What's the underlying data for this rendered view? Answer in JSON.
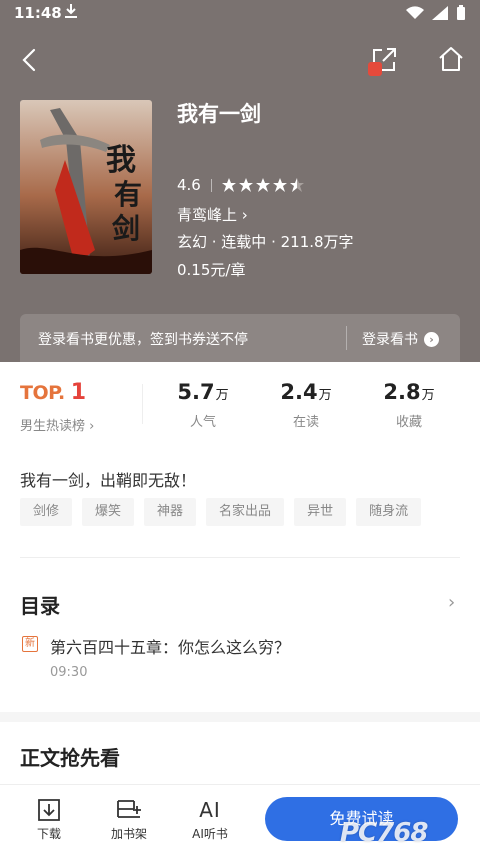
{
  "status_bar": {
    "time": "11:48"
  },
  "book": {
    "title": "我有一剑",
    "cover_title": "我有一剑",
    "rating": "4.6",
    "stars": 4.5,
    "author": "青鸾峰上",
    "meta": "玄幻 · 连载中 · 211.8万字",
    "price": "0.15元/章"
  },
  "promo": {
    "text": "登录看书更优惠，签到书券送不停",
    "button": "登录看书"
  },
  "stats": {
    "rank_top": "TOP.",
    "rank_num": "1",
    "rank_label": "男生热读榜",
    "items": [
      {
        "value": "5.7",
        "unit": "万",
        "label": "人气"
      },
      {
        "value": "2.4",
        "unit": "万",
        "label": "在读"
      },
      {
        "value": "2.8",
        "unit": "万",
        "label": "收藏"
      }
    ]
  },
  "tagline": "我有一剑，出鞘即无敌！",
  "tags": [
    "剑修",
    "爆笑",
    "神器",
    "名家出品",
    "异世",
    "随身流"
  ],
  "toc": {
    "title": "目录",
    "new_badge": "新",
    "latest_chapter": "第六百四十五章：你怎么这么穷？",
    "time": "09:30"
  },
  "preview": {
    "title": "正文抢先看"
  },
  "bottom_bar": {
    "download": "下载",
    "add_shelf": "加书架",
    "ai_icon": "AI",
    "ai_listen": "AI听书",
    "read_free": "免费试读"
  },
  "watermark": "PC768",
  "colors": {
    "header_bg": "#7a7270",
    "accent_blue": "#2f6fe4",
    "rank_orange": "#e5743c",
    "rank_red": "#e5433b"
  },
  "icons": {
    "back": "chevron-left-icon",
    "share": "share-icon",
    "home": "home-icon",
    "download": "download-icon",
    "add_shelf": "add-shelf-icon"
  }
}
